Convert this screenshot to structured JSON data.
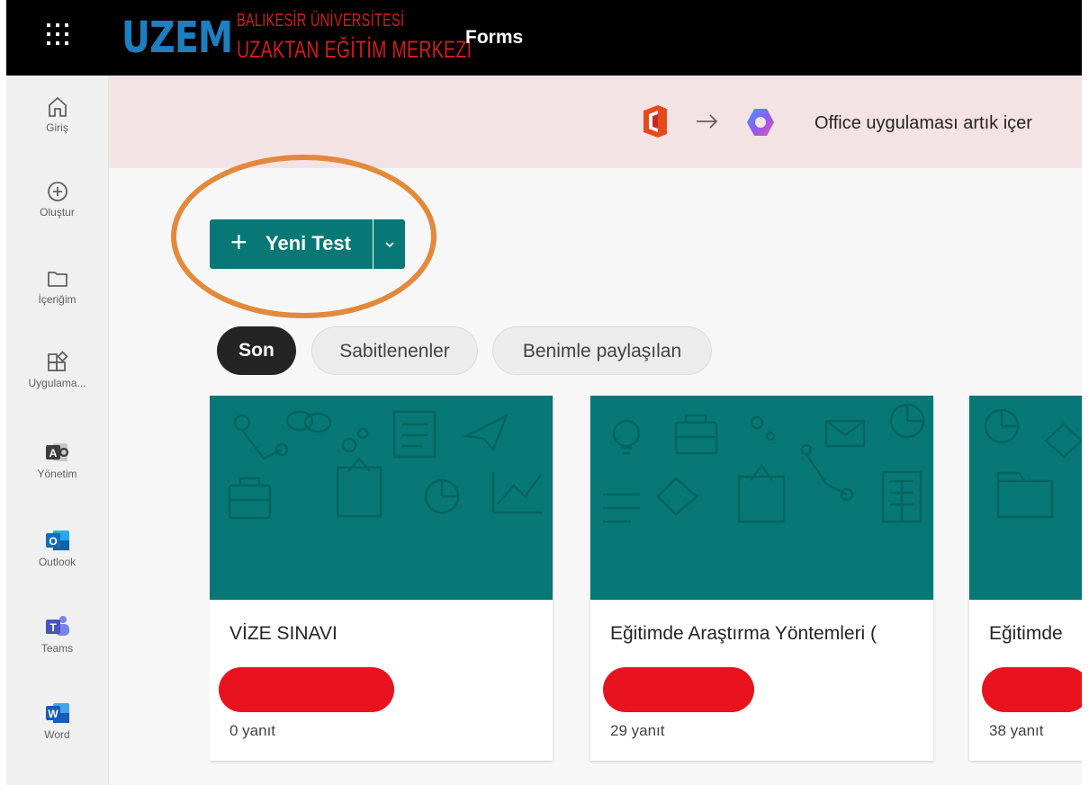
{
  "topbar": {
    "app_launcher_icon": "waffle-icon",
    "logo": {
      "mark": "UZEM",
      "line1": "BALIKESİR ÜNİVERSİTESİ",
      "line2": "UZAKTAN EĞİTİM MERKEZİ"
    },
    "app_name": "Forms"
  },
  "rail": {
    "items": [
      {
        "label": "Giriş",
        "icon": "home-icon"
      },
      {
        "label": "Oluştur",
        "icon": "plus-circle-icon"
      },
      {
        "label": "İçeriğim",
        "icon": "folder-icon"
      },
      {
        "label": "Uygulama...",
        "icon": "apps-icon"
      },
      {
        "label": "Yönetim",
        "icon": "admin-icon"
      },
      {
        "label": "Outlook",
        "icon": "outlook-icon"
      },
      {
        "label": "Teams",
        "icon": "teams-icon"
      },
      {
        "label": "Word",
        "icon": "word-icon"
      }
    ]
  },
  "banner": {
    "text": "Office uygulaması artık içer",
    "icons": [
      "office-icon",
      "arrow-right-icon",
      "copilot-icon"
    ]
  },
  "new_button": {
    "label": "Yeni Test",
    "icon": "plus-icon",
    "dropdown_icon": "chevron-down-icon"
  },
  "filters": [
    {
      "label": "Son",
      "active": true
    },
    {
      "label": "Sabitlenenler",
      "active": false
    },
    {
      "label": "Benimle paylaşılan",
      "active": false
    }
  ],
  "cards": [
    {
      "title": "VİZE SINAVI",
      "responses": "0 yanıt"
    },
    {
      "title": "Eğitimde Araştırma Yöntemleri (",
      "responses": "29 yanıt"
    },
    {
      "title": "Eğitimde",
      "responses": "38 yanıt"
    }
  ],
  "colors": {
    "accent": "#077875",
    "highlight": "#e4883a",
    "redaction": "#e8131f",
    "topbar": "#000000"
  }
}
